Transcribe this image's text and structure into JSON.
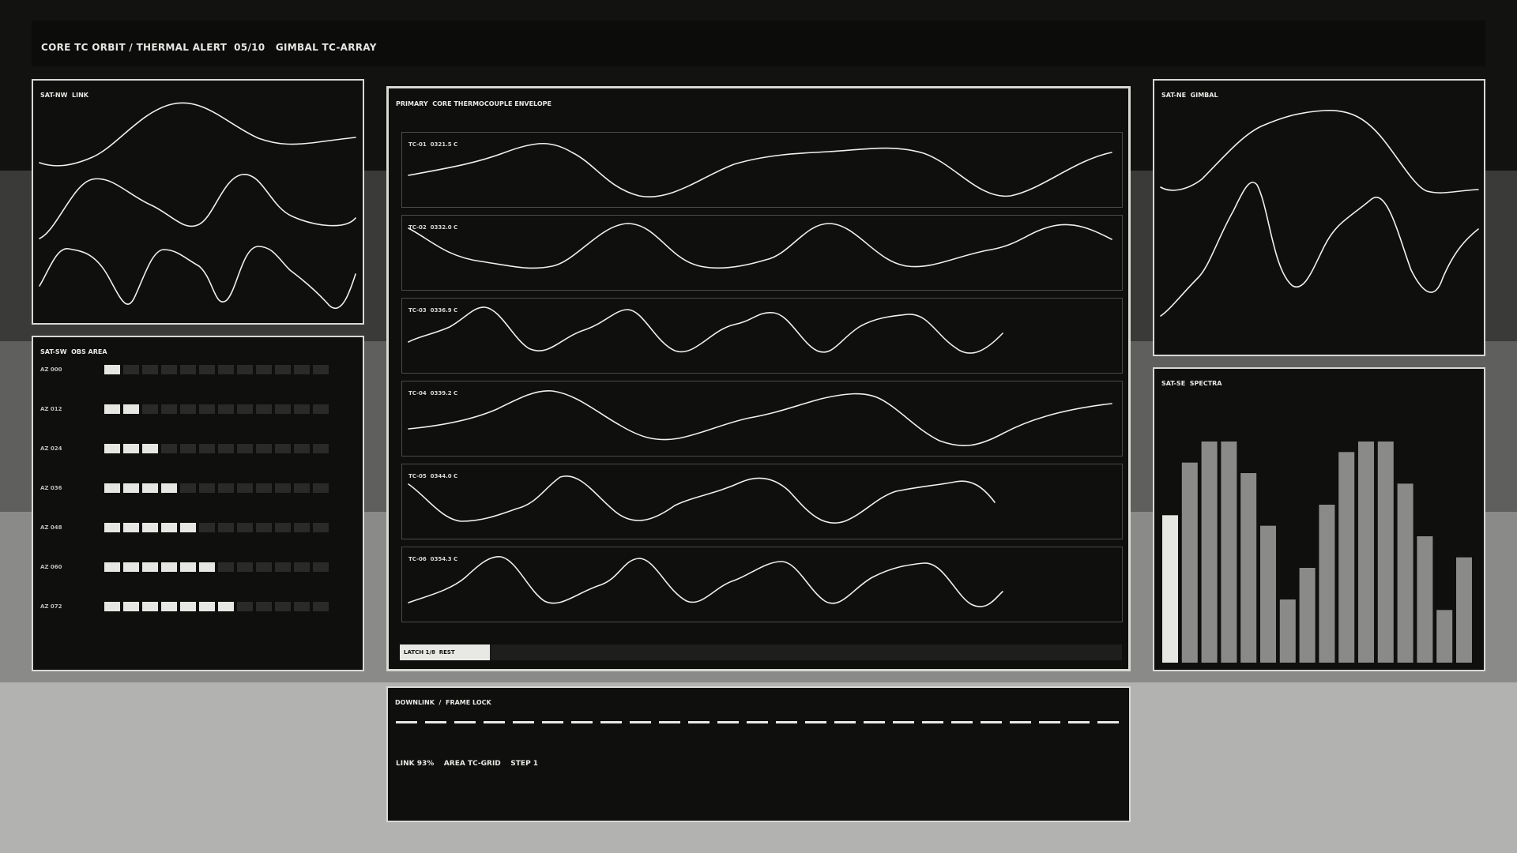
{
  "header": {
    "title": "CORE TC ORBIT / THERMAL ALERT  05/10   GIMBAL TC-ARRAY"
  },
  "panels": {
    "sat_nw": {
      "title": "SAT-NW  LINK"
    },
    "sat_sw": {
      "title": "SAT-SW  OBS AREA",
      "cells_per_row": 12,
      "rows": [
        {
          "label": "AZ 000",
          "lit": 1
        },
        {
          "label": "AZ 012",
          "lit": 2
        },
        {
          "label": "AZ 024",
          "lit": 3
        },
        {
          "label": "AZ 036",
          "lit": 4
        },
        {
          "label": "AZ 048",
          "lit": 5
        },
        {
          "label": "AZ 060",
          "lit": 6
        },
        {
          "label": "AZ 072",
          "lit": 7
        }
      ]
    },
    "primary": {
      "title": "PRIMARY  CORE THERMOCOUPLE ENVELOPE",
      "strips": [
        {
          "label": "TC-01  0321.5 C"
        },
        {
          "label": "TC-02  0332.0 C"
        },
        {
          "label": "TC-03  0336.9 C"
        },
        {
          "label": "TC-04  0339.2 C"
        },
        {
          "label": "TC-05  0344.0 C"
        },
        {
          "label": "TC-06  0354.3 C"
        }
      ],
      "latch": {
        "label": "LATCH 1/8  REST",
        "progress": 0.125
      }
    },
    "sat_ne": {
      "title": "SAT-NE  GIMBAL"
    },
    "sat_se": {
      "title": "SAT-SE  SPECTRA",
      "bars": [
        0.7,
        0.95,
        1.05,
        1.05,
        0.9,
        0.65,
        0.3,
        0.45,
        0.75,
        1.0,
        1.05,
        1.05,
        0.85,
        0.6,
        0.25,
        0.5
      ],
      "highlight_index": 0,
      "colors": {
        "highlight": "#e6e6e2",
        "bar": "#8a8a88"
      }
    },
    "downlink": {
      "title": "DOWNLINK  /  FRAME LOCK",
      "status": "LINK 93%    AREA TC-GRID    STEP 1"
    }
  }
}
